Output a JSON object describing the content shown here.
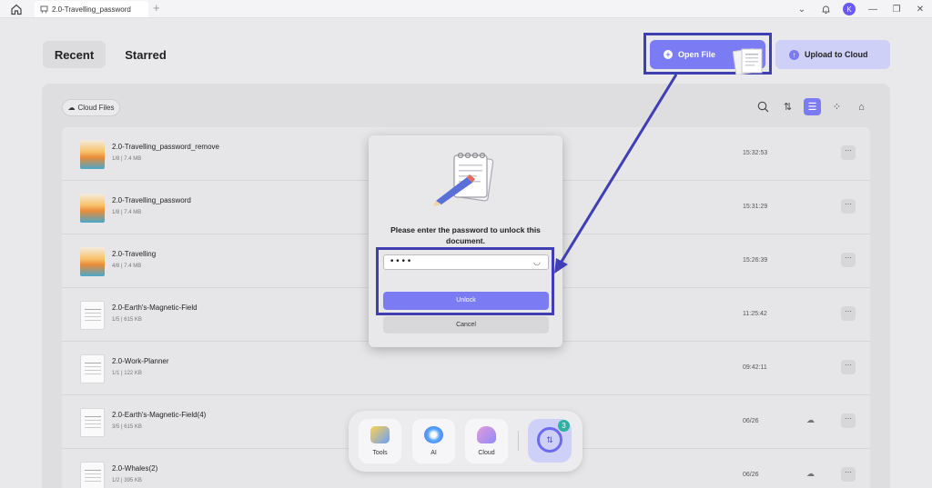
{
  "titlebar": {
    "tab_title": "2.0-Travelling_password",
    "new_tab": "+",
    "avatar_letter": "K"
  },
  "nav": {
    "recent": "Recent",
    "starred": "Starred"
  },
  "actions": {
    "open_file": "Open File",
    "upload": "Upload to Cloud"
  },
  "panel": {
    "cloud_files": "Cloud Files"
  },
  "files": [
    {
      "name": "2.0-Travelling_password_remove",
      "meta": "1/8 | 7.4 MB",
      "time": "15:32:53",
      "thumb": "photo",
      "cloud": false
    },
    {
      "name": "2.0-Travelling_password",
      "meta": "1/8 | 7.4 MB",
      "time": "15:31:29",
      "thumb": "photo",
      "cloud": false
    },
    {
      "name": "2.0-Travelling",
      "meta": "4/8 | 7.4 MB",
      "time": "15:26:39",
      "thumb": "photo",
      "cloud": false
    },
    {
      "name": "2.0-Earth's-Magnetic-Field",
      "meta": "1/5 | 615 KB",
      "time": "11:25:42",
      "thumb": "doc",
      "cloud": false
    },
    {
      "name": "2.0-Work-Planner",
      "meta": "1/1 | 122 KB",
      "time": "09:42:11",
      "thumb": "doc",
      "cloud": false
    },
    {
      "name": "2.0-Earth's-Magnetic-Field(4)",
      "meta": "3/5 | 615 KB",
      "time": "06/26",
      "thumb": "doc",
      "cloud": true
    },
    {
      "name": "2.0-Whales(2)",
      "meta": "1/2 | 395 KB",
      "time": "06/26",
      "thumb": "doc",
      "cloud": true
    }
  ],
  "dialog": {
    "message": "Please enter the password to unlock this document.",
    "password_value": "••••",
    "unlock": "Unlock",
    "cancel": "Cancel"
  },
  "dock": {
    "tools": "Tools",
    "ai": "AI",
    "cloud": "Cloud",
    "sync_badge": "3"
  },
  "colors": {
    "accent": "#7b7cf4",
    "highlight": "#3f3fb3"
  }
}
